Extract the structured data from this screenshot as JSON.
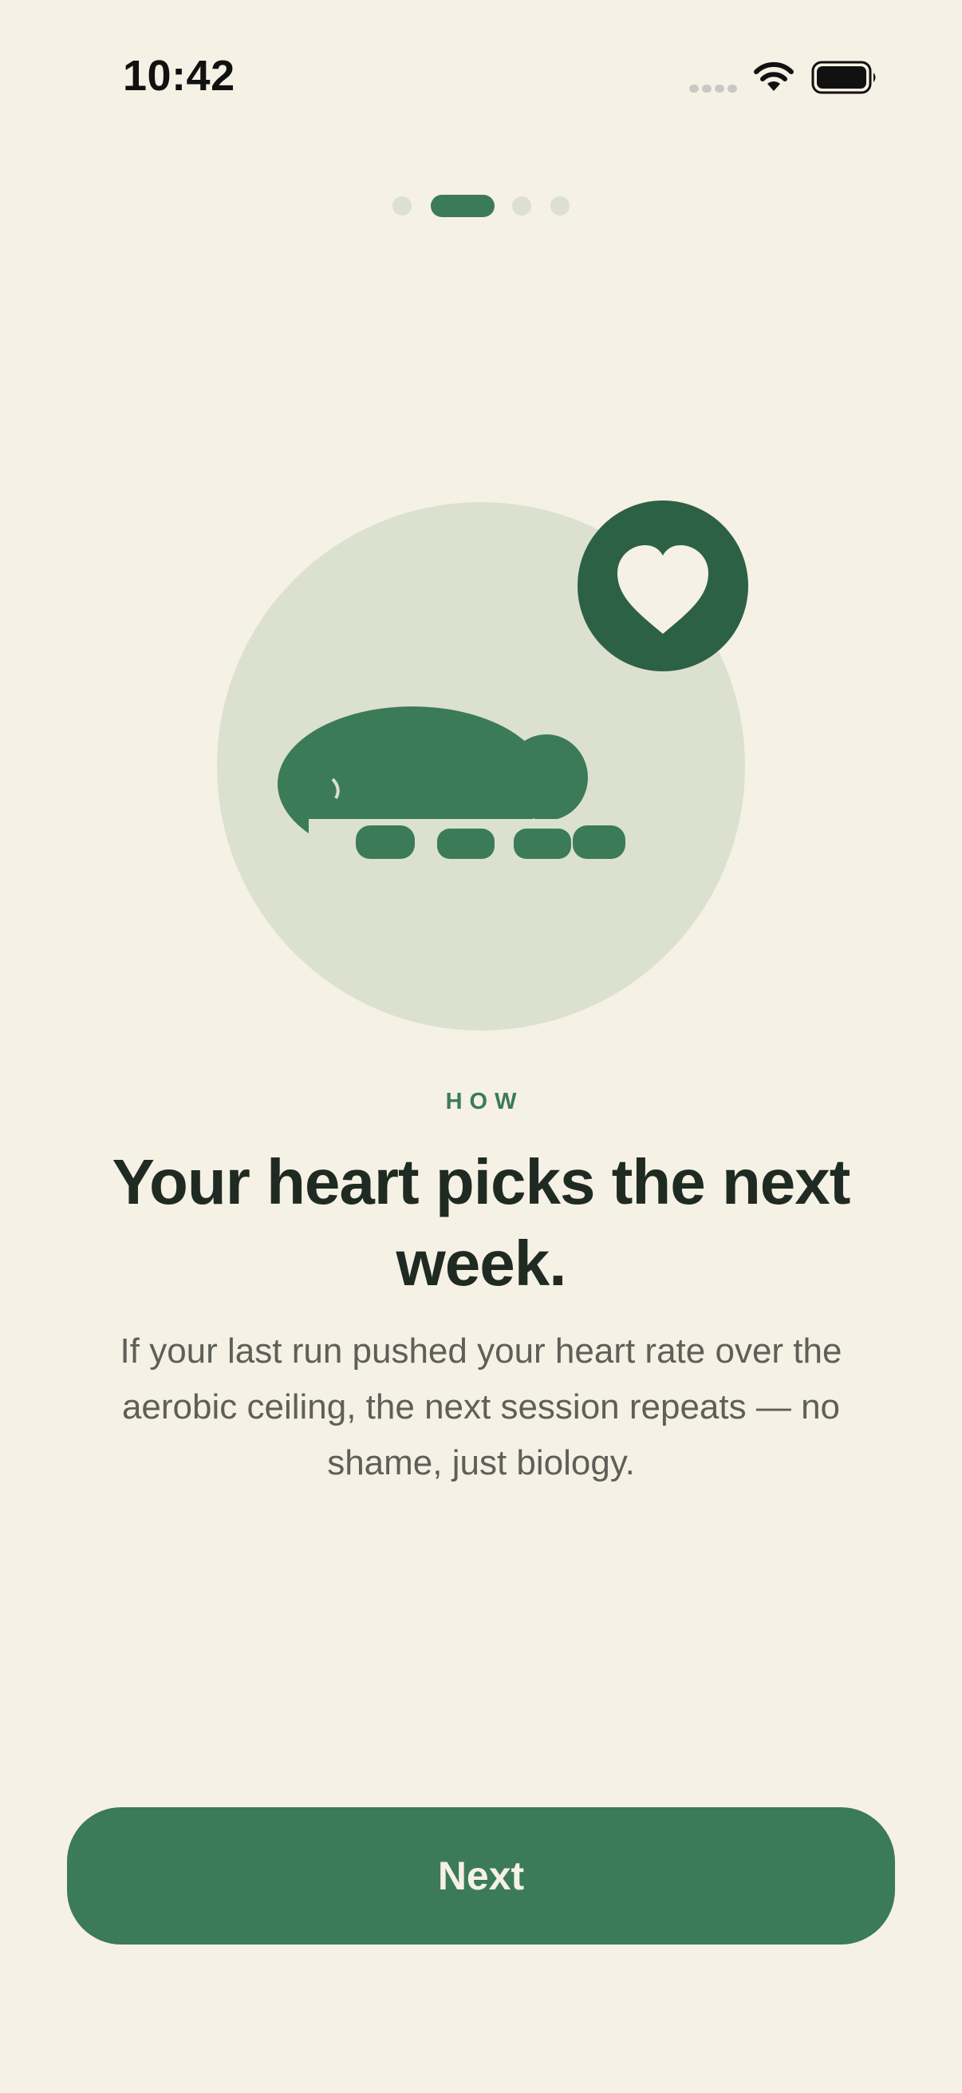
{
  "status_bar": {
    "time": "10:42"
  },
  "pager": {
    "total": 4,
    "current": 2
  },
  "hero": {
    "icons": [
      "turtle-illustration",
      "heart-badge-icon"
    ],
    "colors": {
      "circle": "#dbe0cf",
      "turtle": "#3b7b58",
      "badge": "#2d6146",
      "heart": "#f5f1e4"
    }
  },
  "content": {
    "eyebrow": "HOW",
    "title": "Your heart picks the next week.",
    "body": "If your last run pushed your heart rate over the aerobic ceiling, the next session repeats — no shame, just biology."
  },
  "actions": {
    "next_label": "Next"
  },
  "colors": {
    "background": "#f5f1e4",
    "accent": "#3b7b58",
    "title_text": "#1f2a22",
    "body_text": "#5e5f58"
  }
}
